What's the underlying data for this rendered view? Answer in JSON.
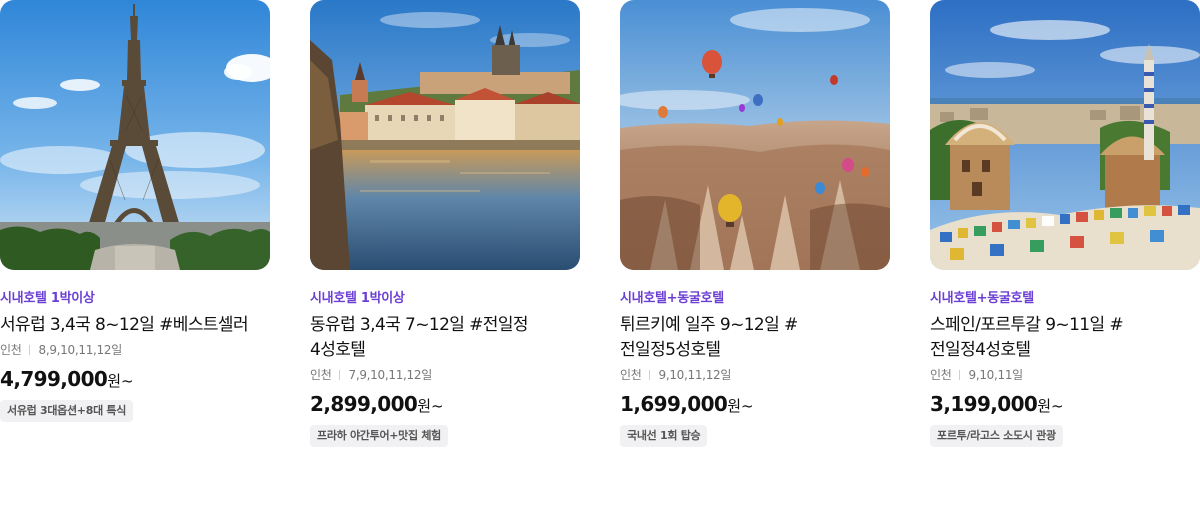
{
  "products": [
    {
      "image": "eiffel-tower-photo",
      "tag": "시내호텔 1박이상",
      "title": "서유럽 3,4국 8~12일 #베스트셀러",
      "departure": "인천",
      "months": "8,9,10,11,12일",
      "price": "4,799,000",
      "currency": "원~",
      "badge": "서유럽 3대옵션+8대 특식"
    },
    {
      "image": "prague-castle-river-photo",
      "tag": "시내호텔 1박이상",
      "title": "동유럽 3,4국 7~12일 #전일정 4성호텔",
      "departure": "인천",
      "months": "7,9,10,11,12일",
      "price": "2,899,000",
      "currency": "원~",
      "badge": "프라하 야간투어+맛집 체험"
    },
    {
      "image": "cappadocia-balloons-photo",
      "tag": "시내호텔+동굴호텔",
      "title": "튀르키예 일주 9~12일 #전일정5성호텔",
      "departure": "인천",
      "months": "9,10,11,12일",
      "price": "1,699,000",
      "currency": "원~",
      "badge": "국내선 1회 탑승"
    },
    {
      "image": "park-guell-barcelona-photo",
      "tag": "시내호텔+동굴호텔",
      "title": "스페인/포르투갈 9~11일 #전일정4성호텔",
      "departure": "인천",
      "months": "9,10,11일",
      "price": "3,199,000",
      "currency": "원~",
      "badge": "포르투/라고스 소도시 관광"
    }
  ],
  "colors": {
    "tag": "#6b3fd4",
    "price": "#111111",
    "meta": "#777777",
    "badge_bg": "#f1f1f3"
  }
}
